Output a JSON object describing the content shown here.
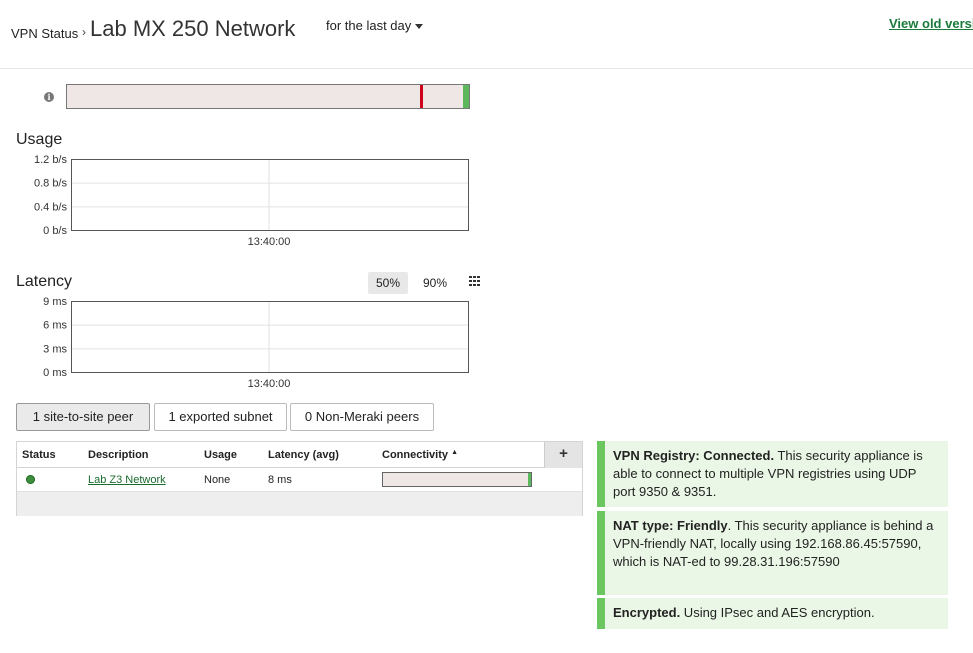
{
  "header": {
    "breadcrumb": "VPN Status",
    "separator": "›",
    "title": "Lab MX 250 Network",
    "timespan": "for the last day",
    "old_link": "View old versi"
  },
  "timeline": {
    "red_marker_fraction": 0.878,
    "green_marker_fraction": 0.985
  },
  "usage": {
    "title": "Usage",
    "chart_data": {
      "type": "line",
      "title": "Usage",
      "y_ticks": [
        "1.2 b/s",
        "0.8 b/s",
        "0.4 b/s",
        "0 b/s"
      ],
      "x_ticks": [
        "13:40:00"
      ],
      "ylim": [
        0,
        1.2
      ],
      "series": []
    }
  },
  "latency": {
    "title": "Latency",
    "pct_50": "50%",
    "pct_90": "90%",
    "chart_data": {
      "type": "line",
      "title": "Latency",
      "y_ticks": [
        "9 ms",
        "6 ms",
        "3 ms",
        "0 ms"
      ],
      "x_ticks": [
        "13:40:00"
      ],
      "ylim": [
        0,
        9
      ],
      "series": []
    }
  },
  "tabs": [
    "1 site-to-site peer",
    "1 exported subnet",
    "0 Non-Meraki peers"
  ],
  "table": {
    "columns": [
      "Status",
      "Description",
      "Usage",
      "Latency (avg)",
      "Connectivity"
    ],
    "sort_indicator": "▲",
    "add_label": "+",
    "rows": [
      {
        "description": "Lab Z3 Network",
        "usage": "None",
        "latency": "8 ms"
      }
    ]
  },
  "notes": {
    "registry_bold": "VPN Registry: Connected.",
    "registry_text": " This security appliance is able to connect to multiple VPN registries using UDP port 9350 & 9351.",
    "nat_bold": "NAT type: Friendly",
    "nat_text": ". This security appliance is behind a VPN-friendly NAT, locally using 192.168.86.45:57590, which is NAT-ed to 99.28.31.196:57590",
    "enc_bold": "Encrypted.",
    "enc_text": " Using IPsec and AES encryption."
  },
  "colors": {
    "accent_green": "#6cc660",
    "link_green": "#1a7a3c",
    "alert_red": "#d0021b",
    "note_bg": "#ebf7e6"
  }
}
